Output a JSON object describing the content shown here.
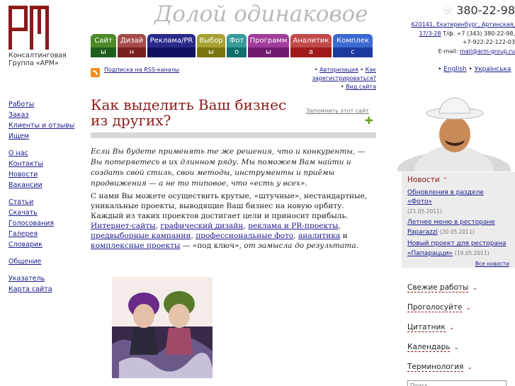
{
  "logo": {
    "letters": "АРМ",
    "line1": "Консалтинговая",
    "line2": "Группа «АРМ»",
    "color": "#8b1a1a"
  },
  "slogan": "Долой одинаковое",
  "contacts": {
    "phone": "380-22-98",
    "address1": "620141, Екатеринбург, Артинская,",
    "address2": "17/3-28",
    "tel_label": " Т/ф. +7 (343) 380-22-98,",
    "mobile": "+7-922-22-122-03",
    "email_label": "E-mail: ",
    "email": "mail@arm-group.ru"
  },
  "tabs": [
    {
      "l1": "Сайт",
      "l2": "ы",
      "color": "#4d8a2a",
      "color2": "#1d5e1d",
      "width": 36
    },
    {
      "l1": "Дизай",
      "l2": "н",
      "color": "#a64a4a",
      "color2": "#7a1f1f",
      "width": 40
    },
    {
      "l1": "Реклама/PR",
      "l2": "",
      "color": "#2a2a8a",
      "color2": "#101060",
      "width": 68
    },
    {
      "l1": "Выбор",
      "l2": "ы",
      "color": "#a6a130",
      "color2": "#7a7510",
      "width": 40
    },
    {
      "l1": "Фот",
      "l2": "о",
      "color": "#3a9a9a",
      "color2": "#0f6f6f",
      "width": 28
    },
    {
      "l1": "Программ",
      "l2": "ы",
      "color": "#a03c9a",
      "color2": "#6e1a6e",
      "width": 58
    },
    {
      "l1": "Аналитик",
      "l2": "а",
      "color": "#c04a4a",
      "color2": "#a01a1a",
      "width": 58
    },
    {
      "l1": "Комплек",
      "l2": "с",
      "color": "#3a6ad0",
      "color2": "#1a3aa0",
      "width": 56
    }
  ],
  "rss_label": "Подписка на RSS-каналы",
  "auth": {
    "login": "Авторизация",
    "register": "Как зарегистрироваться?",
    "site_view": "Вид сайта"
  },
  "lang": {
    "en": "English",
    "uk": "Українська"
  },
  "leftnav": {
    "g1": [
      "Работы",
      "Заказ",
      "Клиенты и отзывы",
      "Ищем"
    ],
    "g2": [
      "О нас",
      "Контакты",
      "Новости",
      "Вакансии"
    ],
    "g3": [
      "Статьи",
      "Скачать",
      "Голосования",
      "Галерея",
      "Словарик"
    ],
    "g4": [
      "Общение"
    ],
    "g5": [
      "Указатель",
      "Карта сайта"
    ]
  },
  "headline": "Как выделить Ваш бизнес из других?",
  "remember": "Запомнить этот сайт",
  "intro": "Если Вы будете применять те же решения, что и конкуренты, — Вы потеряетесь в их длинном ряду. Мы поможем Вам найти и создать свой стиль, свои методы, инструменты и приёмы продвижения — а не то типовое, что «есть у всех».",
  "body": {
    "p1a": "С нами Вы можете осуществить крутые, «штучные», нестандартные, уникальные проекты, выводящие Ваш бизнес на новую орбиту. Каждый из таких проектов достигает цели и приносит прибыль.",
    "links": [
      "Интернет-сайты",
      "графический дизайн",
      "реклама и PR-проекты",
      "предвыборные кампании",
      "профессиональные фото",
      "аналитика",
      "комплексные проекты"
    ],
    "and": " и ",
    "dash": " — «под ключ», ",
    "tail": "от замысла до результата."
  },
  "news": {
    "title": "Новости",
    "items": [
      {
        "text": "Обновления в разделе «Фото»",
        "date": "(21.05.2011)"
      },
      {
        "text": "Летнее меню в ресторане Paparazzi",
        "date": "(20.05.2011)"
      },
      {
        "text": "Новый проект для ресторана «Папарацци»",
        "date": "(19.05.2011)"
      }
    ],
    "all": "Все новости"
  },
  "rblocks": [
    "Свежие работы",
    "Проголосуйте",
    "Цитатник",
    "Календарь",
    "Терминология"
  ],
  "search_placeholder": "Поиск"
}
